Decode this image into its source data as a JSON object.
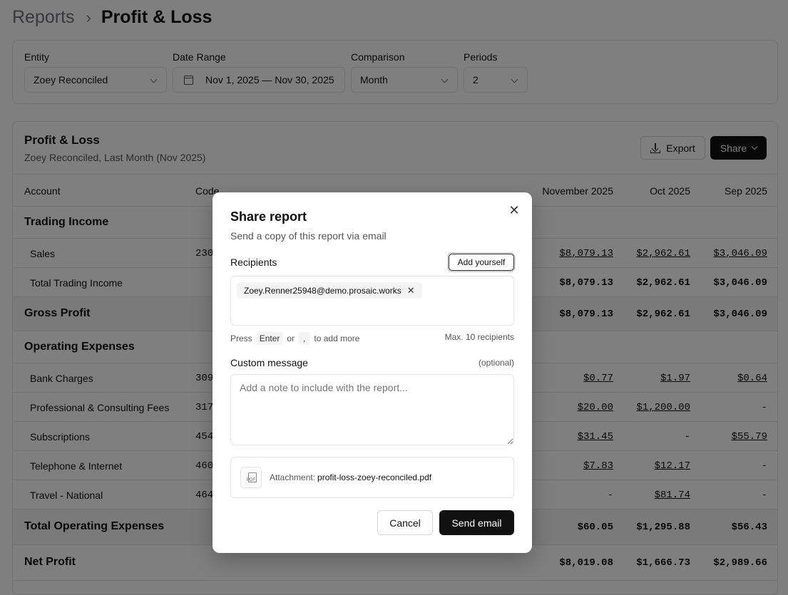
{
  "breadcrumb": {
    "root": "Reports",
    "current": "Profit & Loss"
  },
  "filters": {
    "entity": {
      "label": "Entity",
      "value": "Zoey Reconciled"
    },
    "date_range": {
      "label": "Date Range",
      "value": "Nov 1, 2025 — Nov 30, 2025"
    },
    "comparison": {
      "label": "Comparison",
      "value": "Month"
    },
    "periods": {
      "label": "Periods",
      "value": "2"
    }
  },
  "report": {
    "title": "Profit & Loss",
    "subtitle": "Zoey Reconciled, Last Month (Nov 2025)",
    "export_label": "Export",
    "share_label": "Share",
    "columns": {
      "account": "Account",
      "code": "Code",
      "c1": "November 2025",
      "c2": "Oct 2025",
      "c3": "Sep 2025"
    },
    "rows": [
      {
        "label": "Trading Income",
        "code": "",
        "v1": "",
        "v2": "",
        "v3": ""
      },
      {
        "label": "Sales",
        "code": "230",
        "v1": "$8,079.13",
        "v2": "$2,962.61",
        "v3": "$3,046.09"
      },
      {
        "label": "Total Trading Income",
        "code": "",
        "v1": "$8,079.13",
        "v2": "$2,962.61",
        "v3": "$3,046.09"
      },
      {
        "label": "Gross Profit",
        "code": "",
        "v1": "$8,079.13",
        "v2": "$2,962.61",
        "v3": "$3,046.09"
      },
      {
        "label": "Operating Expenses",
        "code": "",
        "v1": "",
        "v2": "",
        "v3": ""
      },
      {
        "label": "Bank Charges",
        "code": "309",
        "v1": "$0.77",
        "v2": "$1.97",
        "v3": "$0.64"
      },
      {
        "label": "Professional & Consulting Fees",
        "code": "317",
        "v1": "$20.00",
        "v2": "$1,200.00",
        "v3": "-"
      },
      {
        "label": "Subscriptions",
        "code": "454",
        "v1": "$31.45",
        "v2": "-",
        "v3": "$55.79"
      },
      {
        "label": "Telephone & Internet",
        "code": "460",
        "v1": "$7.83",
        "v2": "$12.17",
        "v3": "-"
      },
      {
        "label": "Travel - National",
        "code": "464",
        "v1": "-",
        "v2": "$81.74",
        "v3": "-"
      },
      {
        "label": "Total Operating Expenses",
        "code": "",
        "v1": "$60.05",
        "v2": "$1,295.88",
        "v3": "$56.43"
      },
      {
        "label": "Net Profit",
        "code": "",
        "v1": "$8,019.08",
        "v2": "$1,666.73",
        "v3": "$2,989.66"
      }
    ]
  },
  "modal": {
    "title": "Share report",
    "subtitle": "Send a copy of this report via email",
    "recipients_label": "Recipients",
    "add_yourself": "Add yourself",
    "recipient_chip": "Zoey.Renner25948@demo.prosaic.works",
    "hint_press": "Press",
    "hint_enter": "Enter",
    "hint_or": "or",
    "hint_comma": ",",
    "hint_tail": "to add more",
    "max_recipients": "Max. 10 recipients",
    "message_label": "Custom message",
    "optional": "(optional)",
    "message_placeholder": "Add a note to include with the report...",
    "message_value": "",
    "attachment_icon_text": "PDF",
    "attachment_label": "Attachment:",
    "attachment_file": "profit-loss-zoey-reconciled.pdf",
    "cancel_label": "Cancel",
    "send_label": "Send email",
    "close_glyph": "✕",
    "chip_remove_glyph": "✕"
  }
}
